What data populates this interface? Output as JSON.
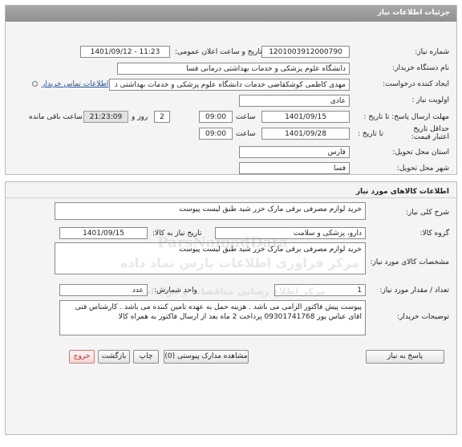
{
  "header": {
    "title": "جزئیات اطلاعات نیاز"
  },
  "need_info": {
    "need_number_label": "شماره نیاز:",
    "need_number": "1201003912000790",
    "announce_label": "تاریخ و ساعت اعلان عمومی:",
    "announce_value": "1401/09/12 - 11:23",
    "buyer_org_label": "نام دستگاه خریدار:",
    "buyer_org": "دانشگاه علوم پزشکی و خدمات بهداشتی درمانی فسا",
    "creator_label": "ایجاد کننده درخواست:",
    "creator": "مهدی  کاظمی کوشکقاضی خدمات دانشگاه علوم پزشکی و خدمات بهداشتی د",
    "contact_link": "اطلاعات تماس خریدار",
    "priority_label": "اولویت نیاز :",
    "priority": "عادی",
    "deadline_label": "مهلت ارسال پاسخ: تا تاریخ :",
    "deadline_date": "1401/09/15",
    "time_label": "ساعت",
    "deadline_time": "09:00",
    "days_value": "2",
    "days_label": "روز و",
    "countdown": "21:23:09",
    "remaining_label": "ساعت باقی مانده",
    "validity_label": "حداقل تاریخ اعتبار قیمت:",
    "validity_to_label": "تا تاریخ :",
    "validity_date": "1401/09/28",
    "validity_time_label": "ساعت",
    "validity_time": "09:00",
    "province_label": "استان محل تحویل:",
    "province": "فارس",
    "city_label": "شهر محل تحویل:",
    "city": "فسا"
  },
  "goods": {
    "title": "اطلاعات کالاهای مورد نیاز",
    "summary_label": "شرح کلی نیاز:",
    "summary": "خرید لوازم مصرفی برقی مارک خزر شید طبق لیست پیوست",
    "group_label": "گروه کالا:",
    "group": "دارو، پزشکی و سلامت",
    "need_date_label": "تاریخ نیاز به کالا:",
    "need_date": "1401/09/15",
    "spec_label": "مشخصات کالای مورد نیاز:",
    "spec": "خرید لوازم مصرفی برقی مارک خزر شید طبق لیست پیوست",
    "qty_label": "تعداد / مقدار مورد نیاز:",
    "qty": "1",
    "unit_label": "واحد شمارش:",
    "unit": "عدد",
    "desc_label": "توضیحات خریدار:",
    "desc": "پیوست پیش فاکتور الزامی می باشد . هزینه حمل به عهده تامین کننده می باشد . کارشناس فنی اقای عباس پور 09301741768  پرداخت 2 ماه بعد از ارسال فاکتور  به همراه کالا"
  },
  "buttons": {
    "reply": "پاسخ به نیاز",
    "attachments": "مشاهده مدارک پیوستی (0)",
    "print": "چاپ",
    "back": "بازگشت",
    "exit": "خروج"
  },
  "watermark": {
    "brand": "ParsNamadData",
    "line1": "مرکز فراوری اطلاعات پارس نماد داده",
    "line2": "مرکز اطلاع رسانی مناقصات و مزایدات"
  },
  "colors": {
    "header_bar": "#9a9a9a",
    "link": "#1f4fb0",
    "exit": "#c62828"
  }
}
